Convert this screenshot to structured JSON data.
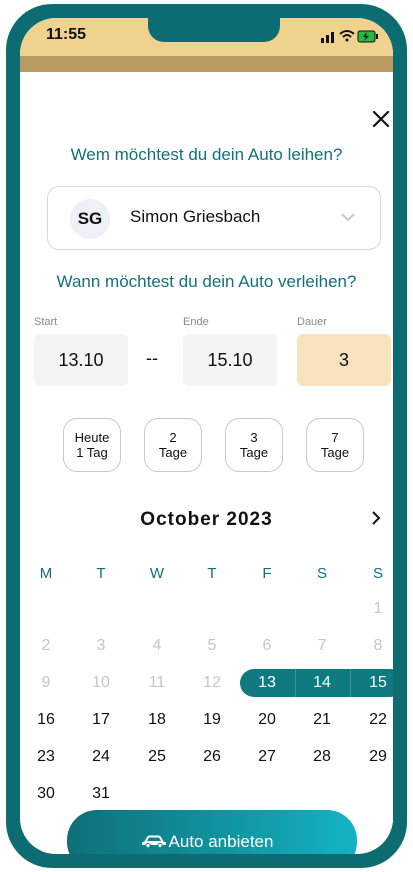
{
  "status": {
    "time": "11:55"
  },
  "dialog": {
    "question_person": "Wem möchtest du dein Auto leihen?",
    "person": {
      "initials": "SG",
      "name": "Simon Griesbach"
    },
    "question_when": "Wann möchtest du dein Auto verleihen?",
    "start": {
      "label": "Start",
      "value": "13.10"
    },
    "separator": "--",
    "end": {
      "label": "Ende",
      "value": "15.10"
    },
    "duration": {
      "label": "Dauer",
      "value": "3"
    },
    "quick_options": [
      {
        "line1": "Heute",
        "line2": "1 Tag"
      },
      {
        "line1": "2",
        "line2": "Tage"
      },
      {
        "line1": "3",
        "line2": "Tage"
      },
      {
        "line1": "7",
        "line2": "Tage"
      }
    ]
  },
  "calendar": {
    "month": "October 2023",
    "weekdays": [
      "M",
      "T",
      "W",
      "T",
      "F",
      "S",
      "S"
    ],
    "weeks": [
      [
        "",
        "",
        "",
        "",
        "",
        "",
        "1"
      ],
      [
        "2",
        "3",
        "4",
        "5",
        "6",
        "7",
        "8"
      ],
      [
        "9",
        "10",
        "11",
        "12",
        "13",
        "14",
        "15"
      ],
      [
        "16",
        "17",
        "18",
        "19",
        "20",
        "21",
        "22"
      ],
      [
        "23",
        "24",
        "25",
        "26",
        "27",
        "28",
        "29"
      ],
      [
        "30",
        "31",
        "",
        "",
        "",
        "",
        ""
      ]
    ],
    "selected": [
      "13",
      "14",
      "15"
    ]
  },
  "cta": {
    "label": "Auto anbieten"
  },
  "colors": {
    "accent": "#12707a",
    "status_bar": "#f0d28f",
    "duration_bg": "#f6e3bd"
  }
}
